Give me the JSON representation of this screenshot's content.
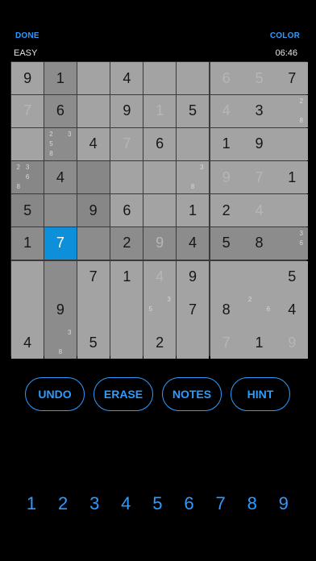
{
  "header": {
    "done_label": "DONE",
    "color_label": "COLOR",
    "difficulty": "EASY",
    "timer": "06:46"
  },
  "colors": {
    "accent": "#2e9bff",
    "selected_cell": "#0d8fd9",
    "cell_normal": "#a3a3a3",
    "cell_highlight": "#8c8c8c"
  },
  "board": {
    "selected": {
      "row": 5,
      "col": 1
    },
    "cells": [
      [
        {
          "v": "9"
        },
        {
          "v": "1"
        },
        {
          "v": ""
        },
        {
          "v": "4"
        },
        {
          "v": ""
        },
        {
          "v": ""
        },
        {
          "v": "6",
          "faded": true
        },
        {
          "v": "5",
          "faded": true
        },
        {
          "v": "7"
        }
      ],
      [
        {
          "v": "7",
          "faded": true
        },
        {
          "v": "6"
        },
        {
          "v": ""
        },
        {
          "v": "9"
        },
        {
          "v": "1",
          "faded": true
        },
        {
          "v": "5"
        },
        {
          "v": "4",
          "faded": true
        },
        {
          "v": "3"
        },
        {
          "v": "",
          "notes": [
            "",
            "",
            "2",
            "",
            "",
            "",
            "",
            "",
            "8"
          ]
        }
      ],
      [
        {
          "v": ""
        },
        {
          "v": "",
          "notes": [
            "2",
            "",
            "3",
            "5",
            "",
            "",
            "8",
            "",
            ""
          ]
        },
        {
          "v": "4"
        },
        {
          "v": "7",
          "faded": true
        },
        {
          "v": "6"
        },
        {
          "v": ""
        },
        {
          "v": "1"
        },
        {
          "v": "9"
        },
        {
          "v": ""
        }
      ],
      [
        {
          "v": "",
          "notes": [
            "2",
            "3",
            "",
            "",
            "6",
            "",
            "8",
            "",
            ""
          ]
        },
        {
          "v": "4"
        },
        {
          "v": ""
        },
        {
          "v": ""
        },
        {
          "v": ""
        },
        {
          "v": "",
          "notes": [
            "",
            "",
            "3",
            "",
            "",
            "",
            "",
            "8",
            ""
          ]
        },
        {
          "v": "9",
          "faded": true
        },
        {
          "v": "7",
          "faded": true
        },
        {
          "v": "1"
        }
      ],
      [
        {
          "v": "5"
        },
        {
          "v": ""
        },
        {
          "v": "9"
        },
        {
          "v": "6"
        },
        {
          "v": ""
        },
        {
          "v": "1"
        },
        {
          "v": "2"
        },
        {
          "v": "4",
          "faded": true
        },
        {
          "v": ""
        }
      ],
      [
        {
          "v": "1"
        },
        {
          "v": "7"
        },
        {
          "v": ""
        },
        {
          "v": "2"
        },
        {
          "v": "9",
          "faded": true
        },
        {
          "v": "4"
        },
        {
          "v": "5"
        },
        {
          "v": "8"
        },
        {
          "v": "",
          "notes": [
            "",
            "",
            "3",
            "",
            "",
            "6",
            "",
            "",
            ""
          ]
        }
      ],
      [
        {
          "v": ""
        },
        {
          "v": ""
        },
        {
          "v": "7"
        },
        {
          "v": "1"
        },
        {
          "v": "4",
          "faded": true
        },
        {
          "v": "9"
        },
        {
          "v": ""
        },
        {
          "v": ""
        },
        {
          "v": "5"
        }
      ],
      [
        {
          "v": ""
        },
        {
          "v": "9"
        },
        {
          "v": ""
        },
        {
          "v": ""
        },
        {
          "v": "",
          "notes": [
            "",
            "",
            "3",
            "5",
            "",
            "",
            "",
            "",
            ""
          ]
        },
        {
          "v": "7"
        },
        {
          "v": "8"
        },
        {
          "v": "",
          "notes": [
            "2",
            "",
            "",
            "",
            "",
            "6",
            "",
            "",
            ""
          ]
        },
        {
          "v": "4"
        }
      ],
      [
        {
          "v": "4"
        },
        {
          "v": "",
          "notes": [
            "",
            "",
            "3",
            "",
            "",
            "",
            "",
            "8",
            ""
          ]
        },
        {
          "v": "5"
        },
        {
          "v": ""
        },
        {
          "v": "2"
        },
        {
          "v": ""
        },
        {
          "v": "7",
          "faded": true
        },
        {
          "v": "1"
        },
        {
          "v": "9",
          "faded": true
        }
      ]
    ]
  },
  "actions": {
    "undo": "UNDO",
    "erase": "ERASE",
    "notes": "NOTES",
    "hint": "HINT"
  },
  "numpad": [
    "1",
    "2",
    "3",
    "4",
    "5",
    "6",
    "7",
    "8",
    "9"
  ]
}
